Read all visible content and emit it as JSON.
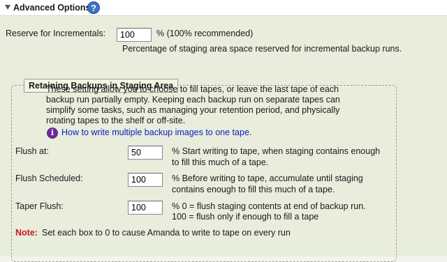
{
  "header": {
    "title": "Advanced Options",
    "help_glyph": "?"
  },
  "reserve": {
    "label": "Reserve for Incrementals:",
    "value": "100",
    "suffix": "% (100% recommended)",
    "description": "Percentage of staging area space reserved for incremental backup runs."
  },
  "staging": {
    "legend": "Retaining Backups in Staging Area",
    "intro_lines": [
      "These setting allow you to choose to fill tapes, or leave the last tape of each",
      "backup run partially empty. Keeping each backup run on separate tapes can",
      "simplify some tasks, such as managing your retention period, and physically",
      "rotating tapes to the shelf or off-site."
    ],
    "info_glyph": "i",
    "link_text": "How to write multiple backup images to one tape.",
    "fields": [
      {
        "label": "Flush at:",
        "value": "50",
        "help_lines": [
          "% Start writing to tape, when staging contains enough",
          "to fill this much of a tape."
        ]
      },
      {
        "label": "Flush Scheduled:",
        "value": "100",
        "help_lines": [
          "% Before writing to tape, accumulate until staging",
          "contains enough to fill this much of a tape."
        ]
      },
      {
        "label": "Taper Flush:",
        "value": "100",
        "help_lines": [
          "% 0 = flush staging contents at end of backup run.",
          "100 = flush only if enough to fill a tape"
        ]
      }
    ],
    "note_label": "Note:",
    "note_text": "Set each box to 0 to cause Amanda to write to tape on every run"
  }
}
